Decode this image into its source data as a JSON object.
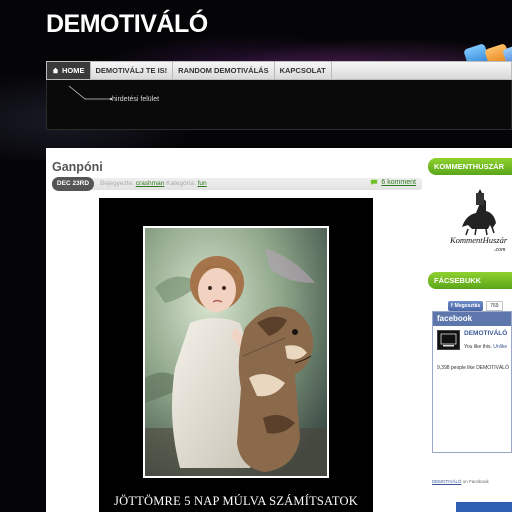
{
  "site": {
    "title": "DEMOTIVÁLÓ"
  },
  "nav": {
    "items": [
      {
        "label": "HOME",
        "icon": "home-icon"
      },
      {
        "label": "DEMOTIVÁLJ TE IS!"
      },
      {
        "label": "RANDOM DEMOTIVÁLÁS"
      },
      {
        "label": "KAPCSOLAT"
      }
    ]
  },
  "ad": {
    "label": "hirdetési felület"
  },
  "post": {
    "title": "Ganpóni",
    "date": "DEC 23RD",
    "posted_by_label": "Bejegyezte:",
    "author": "crashman",
    "category_label": "Kategória:",
    "category": "fun",
    "comments": "6 komment",
    "caption": "JÖTTÖMRE 5 NAP MÚLVA SZÁMÍTSATOK"
  },
  "sidebar": {
    "widget1_title": "KOMMENTHUSZÁR",
    "logo_text_1": "KommentHuszár",
    "logo_text_2": ".com",
    "widget2_title": "FÁCSEBUKK",
    "like_label": "Megosztás",
    "like_count": "769",
    "fb_header": "facebook",
    "fb_page_name": "DEMOTIVÁLÓ",
    "fb_you_like": "You like this.",
    "fb_unlike": "Unlike",
    "fb_people_count": "9,398 people like DEMOTIVÁLÓ",
    "fb_footer_link": "DEMOTIVÁLÓ",
    "fb_footer_suffix": " on Facebook"
  },
  "colors": {
    "accent_green": "#6cbf22",
    "facebook_blue": "#5d77ad"
  }
}
